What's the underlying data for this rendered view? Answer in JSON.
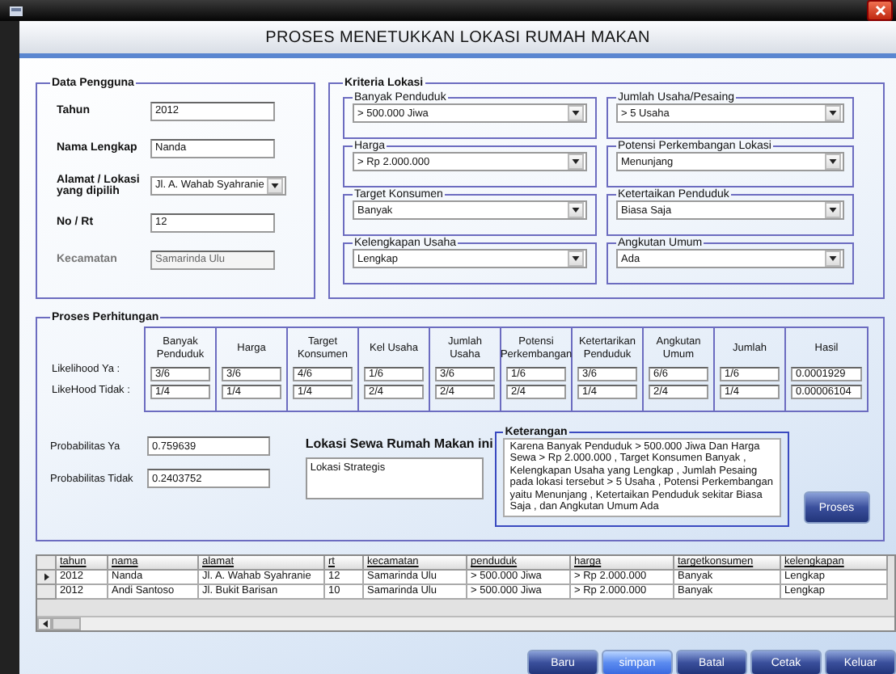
{
  "window": {
    "title": "PROSES MENETUKKAN LOKASI RUMAH MAKAN"
  },
  "data_pengguna": {
    "legend": "Data Pengguna",
    "fields": [
      {
        "label": "Tahun",
        "kind": "text",
        "value": "2012",
        "disabled": false
      },
      {
        "label": "Nama Lengkap",
        "kind": "text",
        "value": "Nanda",
        "disabled": false
      },
      {
        "label": "Alamat / Lokasi yang dipilih",
        "kind": "select",
        "value": "Jl. A. Wahab Syahranie",
        "disabled": false
      },
      {
        "label": "No / Rt",
        "kind": "text",
        "value": "12",
        "disabled": false
      },
      {
        "label": "Kecamatan",
        "kind": "text",
        "value": "Samarinda Ulu",
        "disabled": true
      }
    ]
  },
  "kriteria": {
    "legend": "Kriteria Lokasi",
    "groups": [
      {
        "legend": "Banyak Penduduk",
        "value": "> 500.000 Jiwa"
      },
      {
        "legend": "Jumlah Usaha/Pesaing",
        "value": "> 5 Usaha"
      },
      {
        "legend": "Harga",
        "value": "> Rp 2.000.000"
      },
      {
        "legend": "Potensi Perkembangan Lokasi",
        "value": "Menunjang"
      },
      {
        "legend": "Target Konsumen",
        "value": "Banyak"
      },
      {
        "legend": "Ketertaikan Penduduk",
        "value": "Biasa Saja"
      },
      {
        "legend": "Kelengkapan Usaha",
        "value": "Lengkap"
      },
      {
        "legend": "Angkutan Umum",
        "value": "Ada"
      }
    ]
  },
  "perhitungan": {
    "legend": "Proses Perhitungan",
    "row_labels": [
      "Likelihood Ya :",
      "LikeHood Tidak :"
    ],
    "columns": [
      {
        "header": "Banyak Penduduk",
        "ya": "3/6",
        "tidak": "1/4"
      },
      {
        "header": "Harga",
        "ya": "3/6",
        "tidak": "1/4"
      },
      {
        "header": "Target Konsumen",
        "ya": "4/6",
        "tidak": "1/4"
      },
      {
        "header": "Kel Usaha",
        "ya": "1/6",
        "tidak": "2/4"
      },
      {
        "header": "Jumlah Usaha",
        "ya": "3/6",
        "tidak": "2/4"
      },
      {
        "header": "Potensi Perkembangan",
        "ya": "1/6",
        "tidak": "2/4"
      },
      {
        "header": "Ketertarikan Penduduk",
        "ya": "3/6",
        "tidak": "1/4"
      },
      {
        "header": "Angkutan Umum",
        "ya": "6/6",
        "tidak": "2/4"
      },
      {
        "header": "Jumlah",
        "ya": "1/6",
        "tidak": "1/4"
      },
      {
        "header": "Hasil",
        "ya": "0.0001929",
        "tidak": "0.00006104"
      }
    ],
    "probabilitas": [
      {
        "label": "Probabilitas Ya",
        "value": "0.759639"
      },
      {
        "label": "Probabilitas Tidak",
        "value": "0.2403752"
      }
    ],
    "lokasi_label": "Lokasi Sewa Rumah Makan ini",
    "lokasi_value": "Lokasi Strategis",
    "keterangan_legend": "Keterangan",
    "keterangan": "Karena Banyak Penduduk > 500.000 Jiwa Dan Harga Sewa > Rp 2.000.000 , Target Konsumen Banyak , Kelengkapan Usaha yang Lengkap , Jumlah Pesaing pada lokasi tersebut > 5 Usaha , Potensi Perkembangan yaitu Menunjang , Ketertaikan Penduduk sekitar Biasa Saja , dan Angkutan Umum Ada",
    "proses_button": "Proses"
  },
  "table": {
    "columns": [
      "tahun",
      "nama",
      "alamat",
      "rt",
      "kecamatan",
      "penduduk",
      "harga",
      "targetkonsumen",
      "kelengkapan"
    ],
    "rows": [
      {
        "selected": true,
        "cells": [
          "2012",
          "Nanda",
          "Jl. A. Wahab Syahranie",
          "12",
          "Samarinda Ulu",
          "> 500.000 Jiwa",
          "> Rp 2.000.000",
          "Banyak",
          "Lengkap"
        ]
      },
      {
        "selected": false,
        "cells": [
          "2012",
          "Andi Santoso",
          "Jl. Bukit Barisan",
          "10",
          "Samarinda Ulu",
          "> 500.000 Jiwa",
          "> Rp 2.000.000",
          "Banyak",
          "Lengkap"
        ]
      }
    ]
  },
  "buttons": [
    {
      "label": "Baru",
      "focused": false
    },
    {
      "label": "simpan",
      "focused": true
    },
    {
      "label": "Batal",
      "focused": false
    },
    {
      "label": "Cetak",
      "focused": false
    },
    {
      "label": "Keluar",
      "focused": false
    }
  ]
}
